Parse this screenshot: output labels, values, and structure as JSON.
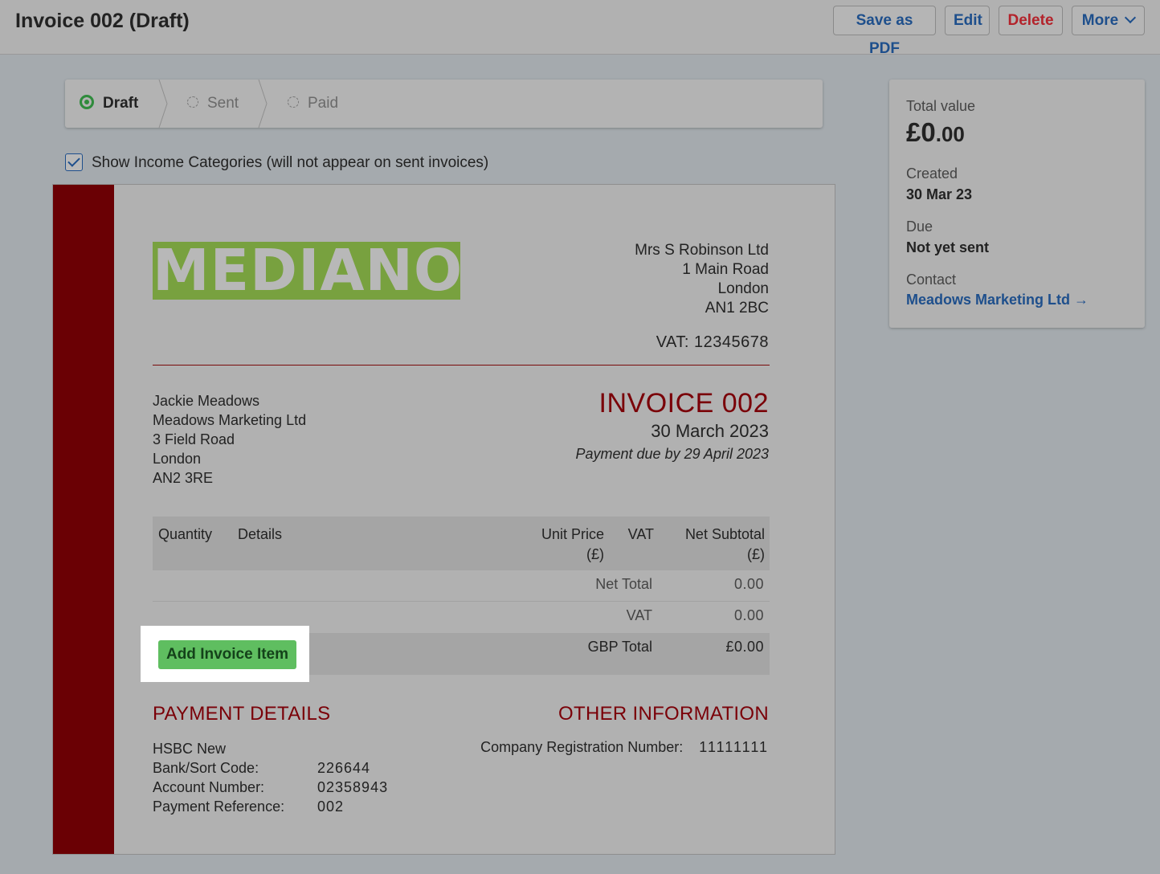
{
  "header": {
    "title": "Invoice 002 (Draft)",
    "buttons": {
      "save_pdf": "Save as PDF",
      "edit": "Edit",
      "delete": "Delete",
      "more": "More"
    }
  },
  "status_steps": {
    "draft": "Draft",
    "sent": "Sent",
    "paid": "Paid",
    "active": "Draft"
  },
  "show_categories": {
    "label": "Show Income Categories (will not appear on sent invoices)",
    "checked": true
  },
  "invoice": {
    "logo_text": "MEDIANODE",
    "from": {
      "name": "Mrs S Robinson Ltd",
      "line1": "1 Main Road",
      "city": "London",
      "postcode": "AN1 2BC",
      "vat": "VAT:  12345678"
    },
    "to": {
      "name": "Jackie Meadows",
      "company": "Meadows Marketing Ltd",
      "line1": "3 Field Road",
      "city": "London",
      "postcode": "AN2 3RE"
    },
    "title": "INVOICE 002",
    "date": "30 March 2023",
    "due": "Payment due by 29 April 2023",
    "table": {
      "col_quantity": "Quantity",
      "col_details": "Details",
      "col_unit_price": "Unit Price",
      "col_unit_price_unit": "(£)",
      "col_vat": "VAT",
      "col_net_subtotal": "Net Subtotal",
      "col_net_subtotal_unit": "(£)"
    },
    "totals": {
      "net_label": "Net Total",
      "net_value": "0.00",
      "vat_label": "VAT",
      "vat_value": "0.00",
      "gbp_label": "GBP Total",
      "gbp_value": "£0.00"
    },
    "add_item_label": "Add Invoice Item",
    "payment": {
      "title": "PAYMENT DETAILS",
      "bank": "HSBC New",
      "sort_label": "Bank/Sort Code:",
      "sort_value": "226644",
      "account_label": "Account Number:",
      "account_value": "02358943",
      "ref_label": "Payment Reference:",
      "ref_value": "002"
    },
    "other": {
      "title": "OTHER INFORMATION",
      "reg_label": "Company Registration Number:",
      "reg_value": "11111111"
    }
  },
  "side": {
    "total_label": "Total value",
    "total_main": "£0",
    "total_dec": ".00",
    "created_label": "Created",
    "created_value": "30 Mar 23",
    "due_label": "Due",
    "due_value": "Not yet sent",
    "contact_label": "Contact",
    "contact_value": "Meadows Marketing Ltd →"
  },
  "colors": {
    "accent": "#1e4f8c",
    "danger": "#b3232b",
    "brand_stripe": "#6a0004",
    "logo_green": "#78a13f",
    "button_green": "#5fbe60"
  }
}
